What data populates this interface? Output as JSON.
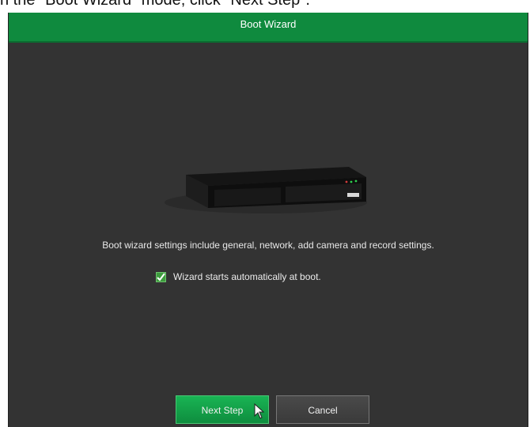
{
  "caption": "n the \"Boot Wizard\" mode, click \"Next Step\".",
  "window": {
    "title": "Boot Wizard"
  },
  "content": {
    "description": "Boot wizard settings include general, network, add camera and record settings.",
    "checkbox_label": "Wizard starts automatically at boot.",
    "checkbox_checked": true
  },
  "buttons": {
    "next": "Next Step",
    "cancel": "Cancel"
  },
  "colors": {
    "titlebar": "#0f8a3e",
    "window_bg": "#333333",
    "next_button": "#19b454"
  },
  "icons": {
    "device": "nvr-device-icon",
    "check": "check-icon",
    "cursor": "mouse-cursor-icon"
  }
}
